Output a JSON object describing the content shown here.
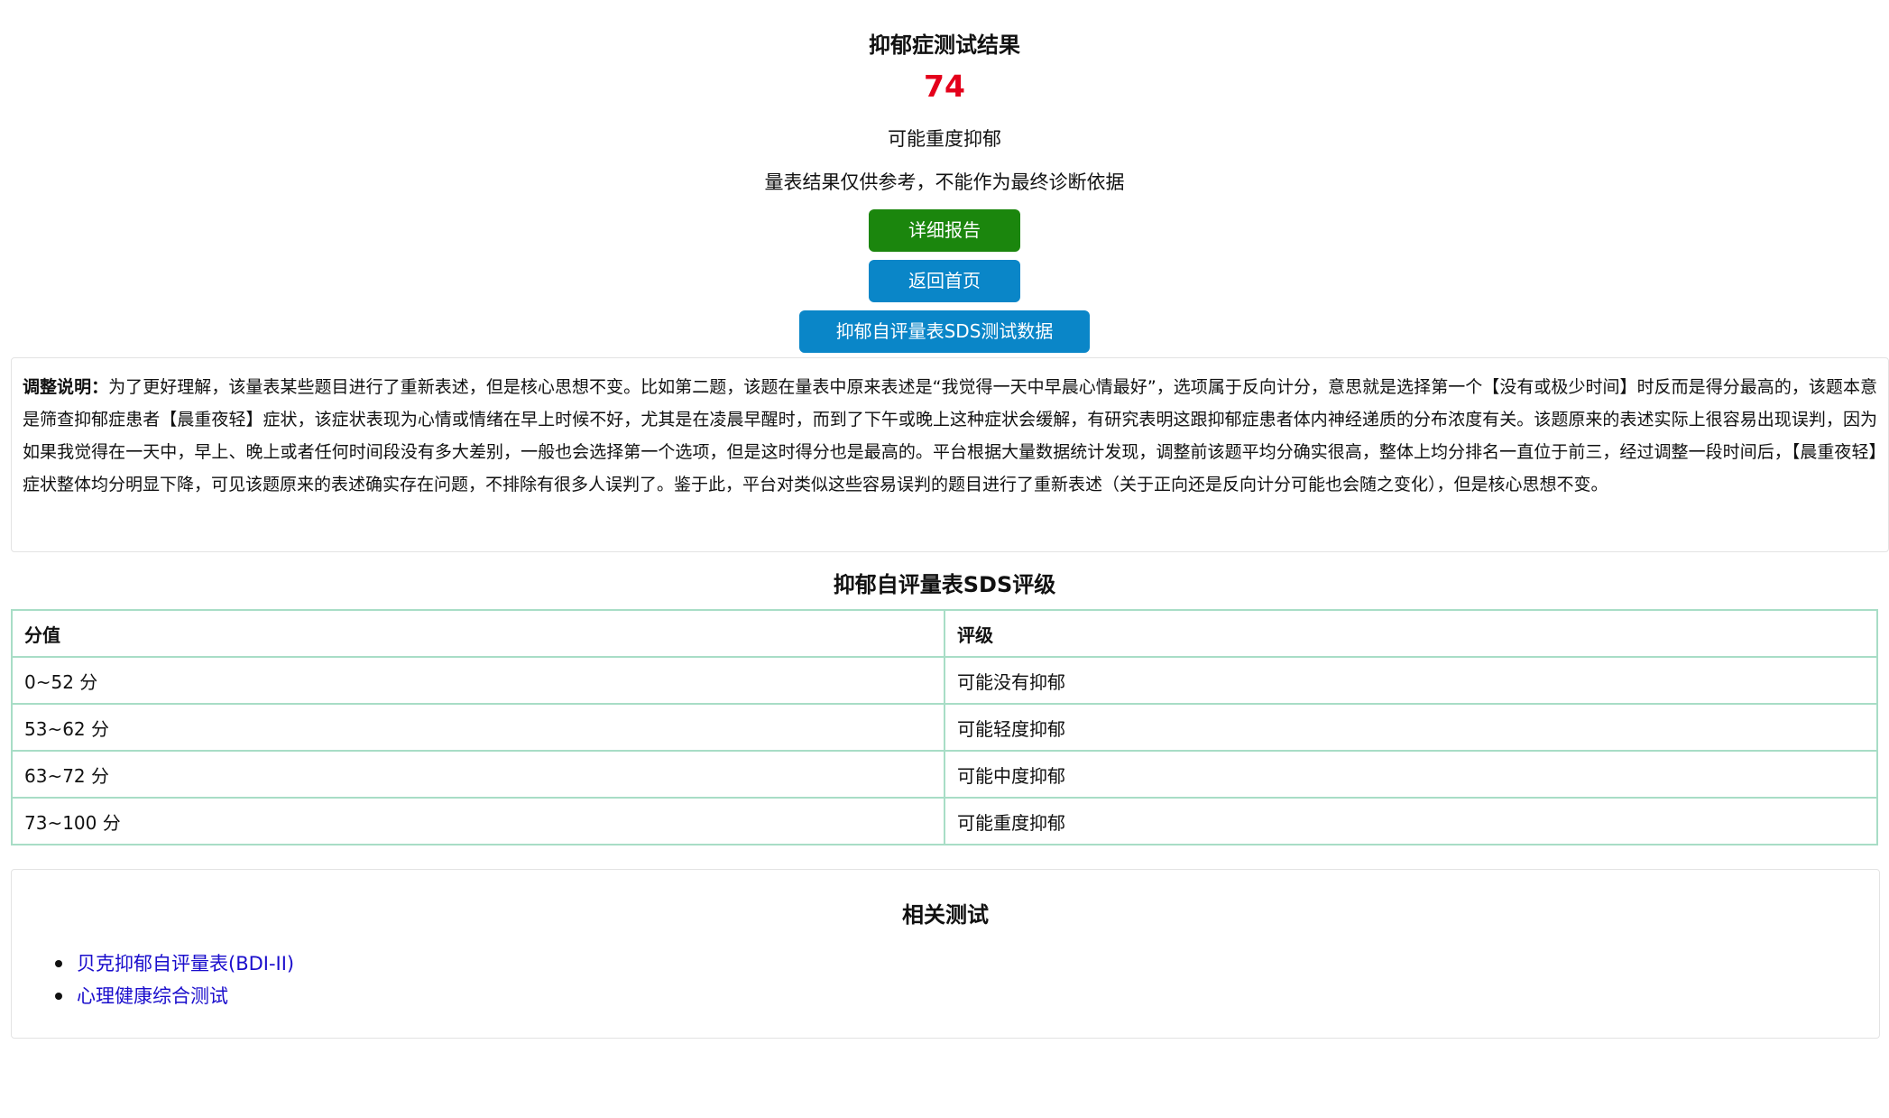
{
  "result": {
    "title": "抑郁症测试结果",
    "score": "74",
    "level": "可能重度抑郁",
    "note": "量表结果仅供参考，不能作为最终诊断依据"
  },
  "buttons": {
    "report": "详细报告",
    "home": "返回首页",
    "data": "抑郁自评量表SDS测试数据"
  },
  "adjustment": {
    "label": "调整说明：",
    "text": "为了更好理解，该量表某些题目进行了重新表述，但是核心思想不变。比如第二题，该题在量表中原来表述是“我觉得一天中早晨心情最好”，选项属于反向计分，意思就是选择第一个【没有或极少时间】时反而是得分最高的，该题本意是筛查抑郁症患者【晨重夜轻】症状，该症状表现为心情或情绪在早上时候不好，尤其是在凌晨早醒时，而到了下午或晚上这种症状会缓解，有研究表明这跟抑郁症患者体内神经递质的分布浓度有关。该题原来的表述实际上很容易出现误判，因为如果我觉得在一天中，早上、晚上或者任何时间段没有多大差别，一般也会选择第一个选项，但是这时得分也是最高的。平台根据大量数据统计发现，调整前该题平均分确实很高，整体上均分排名一直位于前三，经过调整一段时间后，【晨重夜轻】症状整体均分明显下降，可见该题原来的表述确实存在问题，不排除有很多人误判了。鉴于此，平台对类似这些容易误判的题目进行了重新表述（关于正向还是反向计分可能也会随之变化），但是核心思想不变。"
  },
  "grading": {
    "title": "抑郁自评量表SDS评级",
    "headers": [
      "分值",
      "评级"
    ],
    "rows": [
      [
        "0~52 分",
        "可能没有抑郁"
      ],
      [
        "53~62 分",
        "可能轻度抑郁"
      ],
      [
        "63~72 分",
        "可能中度抑郁"
      ],
      [
        "73~100 分",
        "可能重度抑郁"
      ]
    ]
  },
  "related": {
    "title": "相关测试",
    "links": [
      "贝克抑郁自评量表(BDI-II)",
      "心理健康综合测试"
    ]
  },
  "colors": {
    "score": "#e4001b",
    "report_button": "#1b860d",
    "primary_button": "#0a86c8",
    "table_border": "#a8ddc6",
    "link": "#1a0dcc"
  }
}
